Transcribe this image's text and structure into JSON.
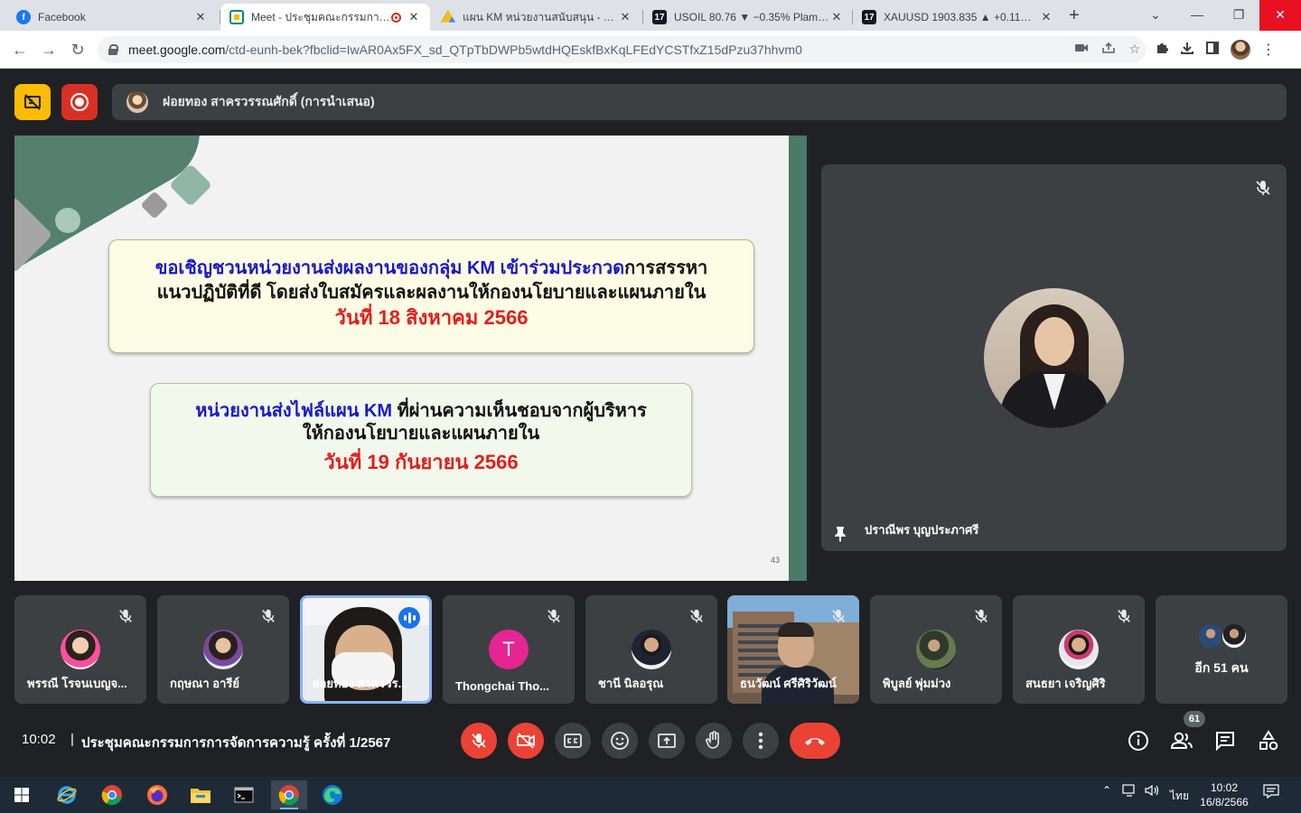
{
  "browser": {
    "tabs": [
      {
        "title": "Facebook",
        "favicon": "facebook-icon",
        "color": "#1877f2"
      },
      {
        "title": "Meet - ประชุมคณะกรรมการการ",
        "favicon": "meet-icon",
        "color": "#00897b",
        "active": true,
        "recording": true
      },
      {
        "title": "แผน KM หน่วยงานสนับสนุน - Goog",
        "favicon": "drive-icon",
        "color": "#fbbc04"
      },
      {
        "title": "USOIL 80.76 ▼ −0.35% Plamy_C",
        "favicon": "tradingview-icon",
        "color": "#131722"
      },
      {
        "title": "XAUUSD 1903.835 ▲ +0.11% Pl",
        "favicon": "tradingview-icon",
        "color": "#131722"
      }
    ],
    "url_host": "meet.google.com",
    "url_rest": "/ctd-eunh-bek?fbclid=IwAR0Ax5FX_sd_QTpTbDWPb5wtdHQEskfBxKqLFEdYCSTfxZ15dPzu37hhvm0"
  },
  "meet": {
    "presenter_label": "ฝอยทอง สาครวรรณศักดิ์ (การนำเสนอ)",
    "slide": {
      "box1_line1_blue": "ขอเชิญชวนหน่วยงานส่งผลงานของกลุ่ม KM เข้าร่วมประกวด",
      "box1_line1_black": "การสรรหา",
      "box1_line2": "แนวปฏิบัติที่ดี โดยส่งใบสมัครและผลงานให้กองนโยบายและแผนภายใน",
      "box1_date": "วันที่ 18 สิงหาคม 2566",
      "box2_line1_blue": "หน่วยงานส่งไฟล์แผน KM",
      "box2_line1_black": "ที่ผ่านความเห็นชอบจากผู้บริหาร",
      "box2_line2": "ให้กองนโยบายและแผนภายใน",
      "box2_date": "วันที่ 19 กันยายน 2566",
      "page_number": "43"
    },
    "pinned_name": "ปราณีพร บุญประภาศรี",
    "participants": [
      {
        "name": "พรรณี โรจนเบญจ..."
      },
      {
        "name": "กฤษณา อารีย์"
      },
      {
        "name": "ฝอยทอง สาครวร..."
      },
      {
        "name": "Thongchai Tho...",
        "initial": "T"
      },
      {
        "name": "ชานี นิลอรุณ"
      },
      {
        "name": "ธนวัฒน์ ศรีศิริวัฒน์"
      },
      {
        "name": "พิบูลย์ พุ่มม่วง"
      },
      {
        "name": "สนธยา เจริญศิริ"
      }
    ],
    "more_label": "อีก 51 คน",
    "time": "10:02",
    "separator": "|",
    "meeting_title": "ประชุมคณะกรรมการการจัดการความรู้ ครั้งที่ 1/2567",
    "participant_count": "61",
    "colors": {
      "accent_red": "#ea4335",
      "tile_bg": "#3c4043",
      "bg": "#202124"
    }
  },
  "taskbar": {
    "lang": "ไทย",
    "clock_time": "10:02",
    "clock_date": "16/8/2566"
  }
}
